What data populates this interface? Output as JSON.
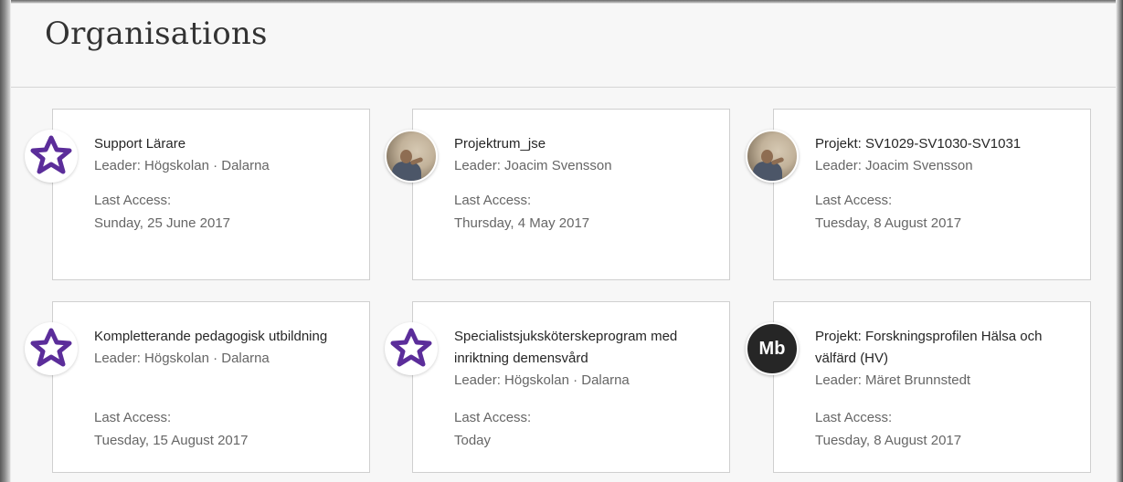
{
  "header": {
    "title": "Organisations"
  },
  "cards": [
    {
      "title": "Support Lärare",
      "leader": "Leader: Högskolan · Dalarna",
      "access_label": "Last Access:",
      "access_date": "Sunday, 25 June 2017",
      "avatar": "star-icon"
    },
    {
      "title": "Projektrum_jse",
      "leader": "Leader: Joacim Svensson",
      "access_label": "Last Access:",
      "access_date": "Thursday, 4 May 2017",
      "avatar": "photo"
    },
    {
      "title": "Projekt: SV1029-SV1030-SV1031",
      "leader": "Leader: Joacim Svensson",
      "access_label": "Last Access:",
      "access_date": "Tuesday, 8 August 2017",
      "avatar": "photo"
    },
    {
      "title": "Kompletterande pedagogisk utbildning",
      "leader": "Leader: Högskolan · Dalarna",
      "access_label": "Last Access:",
      "access_date": "Tuesday, 15 August 2017",
      "avatar": "star-icon"
    },
    {
      "title": "Specialistsjuksköterskeprogram med inriktning demensvård",
      "leader": "Leader: Högskolan · Dalarna",
      "access_label": "Last Access:",
      "access_date": "Today",
      "avatar": "star-icon"
    },
    {
      "title": "Projekt: Forskningsprofilen Hälsa och välfärd (HV)",
      "leader": "Leader: Märet Brunnstedt",
      "access_label": "Last Access:",
      "access_date": "Tuesday, 8 August 2017",
      "avatar": "initials",
      "initials": "Mb"
    }
  ],
  "colors": {
    "star_fill": "#5b2d9a",
    "initials_bg": "#262626",
    "header_bg": "#f7f7f7"
  }
}
